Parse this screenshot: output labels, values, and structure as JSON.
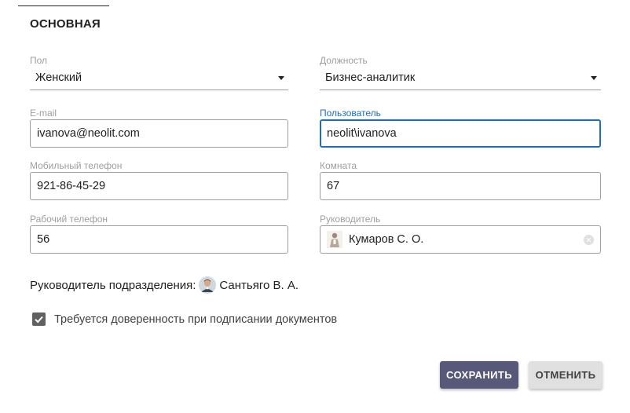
{
  "section": {
    "title": "ОСНОВНАЯ"
  },
  "fields": {
    "gender": {
      "label": "Пол",
      "value": "Женский"
    },
    "position": {
      "label": "Должность",
      "value": "Бизнес-аналитик"
    },
    "email": {
      "label": "E-mail",
      "value": "ivanova@neolit.com"
    },
    "user": {
      "label": "Пользователь",
      "value": "neolit\\ivanova"
    },
    "mobile": {
      "label": "Мобильный телефон",
      "value": "921-86-45-29"
    },
    "room": {
      "label": "Комната",
      "value": "67"
    },
    "work_phone": {
      "label": "Рабочий телефон",
      "value": "56"
    },
    "manager": {
      "label": "Руководитель",
      "value": "Кумаров С. О."
    }
  },
  "department_head": {
    "label": "Руководитель подразделения:",
    "name": "Сантьяго В. А."
  },
  "power_of_attorney": {
    "label": "Требуется доверенность при подписании документов",
    "checked": true
  },
  "actions": {
    "save_label": "СОХРАНИТЬ",
    "cancel_label": "ОТМЕНИТЬ"
  },
  "colors": {
    "focus": "#1e6fbf",
    "primary_button": "#57587a",
    "secondary_button": "#e0e0e0"
  }
}
